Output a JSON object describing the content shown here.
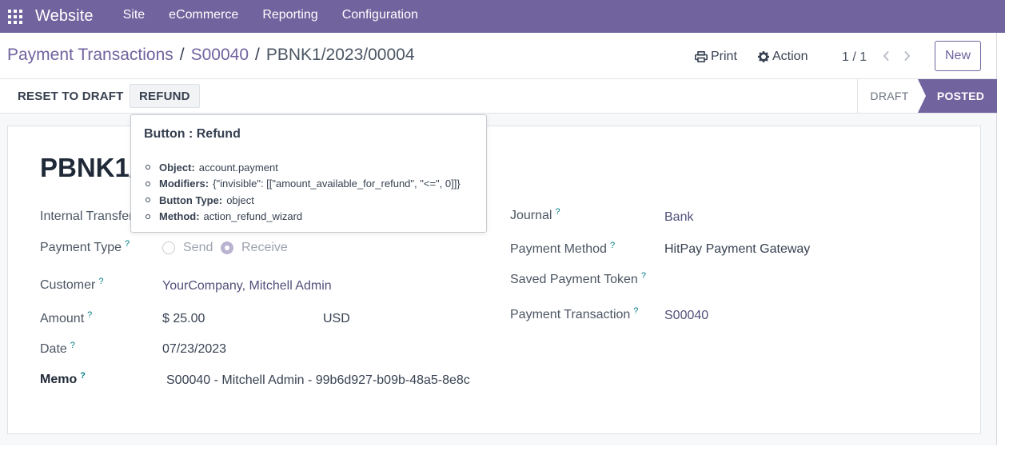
{
  "navbar": {
    "brand": "Website",
    "items": [
      "Site",
      "eCommerce",
      "Reporting",
      "Configuration"
    ]
  },
  "breadcrumb": {
    "items": [
      "Payment Transactions",
      "S00040"
    ],
    "current": "PBNK1/2023/00004",
    "separator": "/"
  },
  "control": {
    "print_label": "Print",
    "action_label": "Action",
    "pager": "1 / 1",
    "new_label": "New"
  },
  "statusbar": {
    "reset_label": "RESET TO DRAFT",
    "refund_label": "REFUND",
    "stages": [
      "DRAFT",
      "POSTED"
    ],
    "active_stage": "POSTED"
  },
  "tooltip": {
    "title": "Button : Refund",
    "rows": [
      {
        "key": "Object:",
        "value": "account.payment"
      },
      {
        "key": "Modifiers:",
        "value": "{\"invisible\": [[\"amount_available_for_refund\", \"<=\", 0]]}"
      },
      {
        "key": "Button Type:",
        "value": "object"
      },
      {
        "key": "Method:",
        "value": "action_refund_wizard"
      }
    ]
  },
  "form": {
    "record_name": "PBNK1/2023/00004",
    "internal_transfer_label": "Internal Transfer",
    "payment_type_label": "Payment Type",
    "payment_type_options": [
      "Send",
      "Receive"
    ],
    "payment_type_selected": "Receive",
    "customer_label": "Customer",
    "customer_value": "YourCompany, Mitchell Admin",
    "amount_label": "Amount",
    "amount_value": "$ 25.00",
    "currency_value": "USD",
    "date_label": "Date",
    "date_value": "07/23/2023",
    "memo_label": "Memo",
    "memo_value": "S00040 - Mitchell Admin - 99b6d927-b09b-48a5-8e8c",
    "journal_label": "Journal",
    "journal_value": "Bank",
    "payment_method_label": "Payment Method",
    "payment_method_value": "HitPay Payment Gateway",
    "saved_token_label": "Saved Payment Token",
    "saved_token_value": "",
    "payment_transaction_label": "Payment Transaction",
    "payment_transaction_value": "S00040",
    "help_mark": "?"
  },
  "colors": {
    "brand": "#71639e",
    "link": "#51507a",
    "help": "#017e84"
  }
}
